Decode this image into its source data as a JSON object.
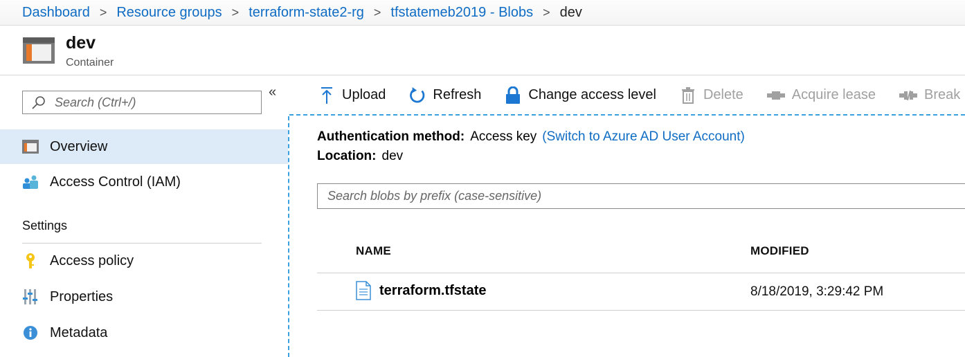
{
  "breadcrumb": {
    "items": [
      "Dashboard",
      "Resource groups",
      "terraform-state2-rg",
      "tfstatemeb2019 - Blobs"
    ],
    "current": "dev",
    "separator": ">"
  },
  "header": {
    "title": "dev",
    "subtitle": "Container"
  },
  "sidebar": {
    "search_placeholder": "Search (Ctrl+/)",
    "collapse_glyph": "«",
    "items": [
      {
        "label": "Overview",
        "icon": "container-icon"
      },
      {
        "label": "Access Control (IAM)",
        "icon": "users-icon"
      }
    ],
    "settings_title": "Settings",
    "settings_items": [
      {
        "label": "Access policy",
        "icon": "key-icon"
      },
      {
        "label": "Properties",
        "icon": "properties-icon"
      },
      {
        "label": "Metadata",
        "icon": "info-icon"
      }
    ]
  },
  "toolbar": {
    "upload": "Upload",
    "refresh": "Refresh",
    "change_access": "Change access level",
    "delete": "Delete",
    "acquire_lease": "Acquire lease",
    "break_lease": "Break lease"
  },
  "main": {
    "auth_label": "Authentication method:",
    "auth_value": "Access key",
    "auth_link": "(Switch to Azure AD User Account)",
    "location_label": "Location:",
    "location_value": "dev",
    "blob_search_placeholder": "Search blobs by prefix (case-sensitive)",
    "columns": [
      "NAME",
      "MODIFIED"
    ],
    "rows": [
      {
        "name": "terraform.tfstate",
        "modified": "8/18/2019, 3:29:42 PM"
      }
    ]
  },
  "colors": {
    "accent": "#0f6cc4",
    "selected_bg": "#ddeaf7",
    "divider": "#3aa0e0",
    "disabled": "#a0a0a0"
  }
}
